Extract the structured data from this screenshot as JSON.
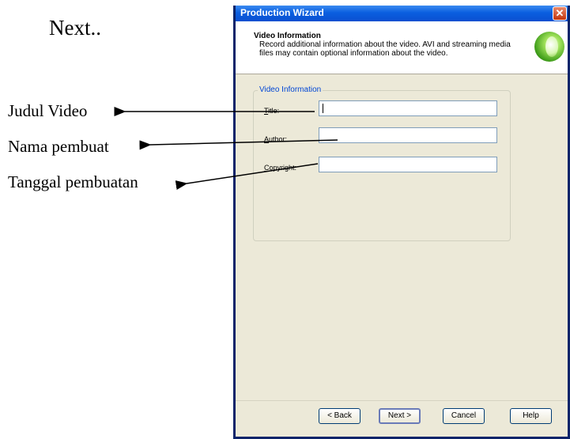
{
  "annotations": {
    "next": "Next..",
    "judul_video": "Judul Video",
    "nama_pembuat": "Nama pembuat",
    "tanggal_pembuatan": "Tanggal pembuatan"
  },
  "window": {
    "title": "Production Wizard",
    "close_glyph": "✕"
  },
  "header": {
    "title": "Video Information",
    "description": "Record additional information about the video.  AVI and streaming media files may contain optional information about the video.",
    "logo_icon": "green-orb-icon"
  },
  "group": {
    "legend": "Video Information",
    "fields": [
      {
        "label_accel": "T",
        "label_rest": "itle:",
        "value": ""
      },
      {
        "label_accel": "A",
        "label_rest": "uthor:",
        "value": ""
      },
      {
        "label_accel": "C",
        "label_rest": "opyright:",
        "value": ""
      }
    ]
  },
  "buttons": {
    "back": "< Back",
    "next": "Next >",
    "cancel": "Cancel",
    "help": "Help"
  },
  "colors": {
    "titlebar": "#0a5fe0",
    "window_bg": "#ece9d8",
    "group_legend": "#0046d5"
  }
}
